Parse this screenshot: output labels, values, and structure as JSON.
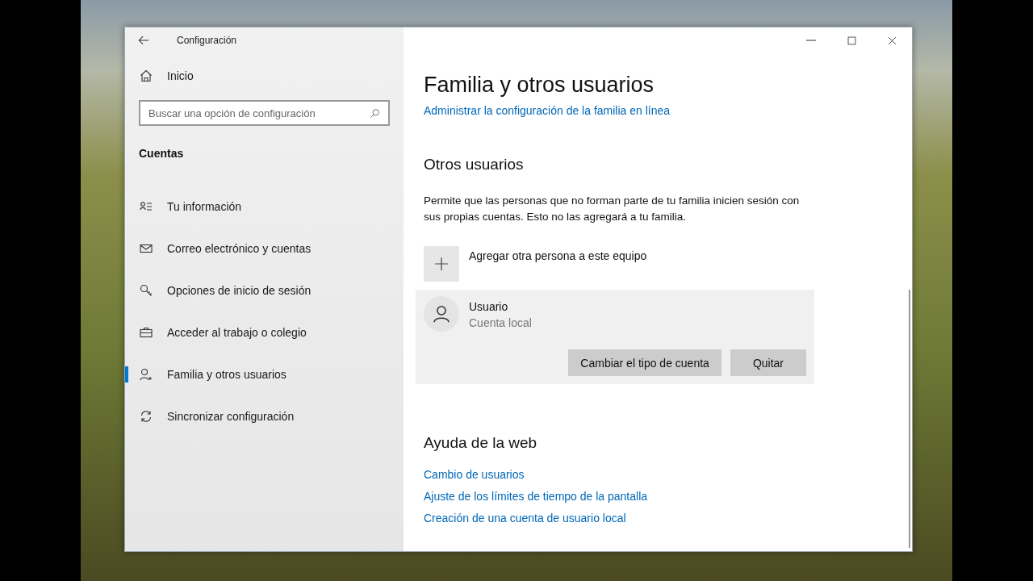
{
  "window": {
    "title": "Configuración"
  },
  "sidebar": {
    "home": "Inicio",
    "search": {
      "placeholder": "Buscar una opción de configuración"
    },
    "section": "Cuentas",
    "items": [
      {
        "label": "Tu información",
        "kind": "info",
        "selected": false
      },
      {
        "label": "Correo electrónico y cuentas",
        "kind": "mail",
        "selected": false
      },
      {
        "label": "Opciones de inicio de sesión",
        "kind": "key",
        "selected": false
      },
      {
        "label": "Acceder al trabajo o colegio",
        "kind": "briefcase",
        "selected": false
      },
      {
        "label": "Familia y otros usuarios",
        "kind": "family",
        "selected": true
      },
      {
        "label": "Sincronizar configuración",
        "kind": "sync",
        "selected": false
      }
    ]
  },
  "main": {
    "title": "Familia y otros usuarios",
    "family_link": "Administrar la configuración de la familia en línea",
    "other_users": {
      "heading": "Otros usuarios",
      "description": "Permite que las personas que no forman parte de tu familia inicien sesión con sus propias cuentas. Esto no las agregará a tu familia.",
      "add_label": "Agregar otra persona a este equipo",
      "user": {
        "name": "Usuario",
        "type": "Cuenta local",
        "expanded": true,
        "buttons": [
          "Cambiar el tipo de cuenta",
          "Quitar"
        ]
      }
    },
    "web_help": {
      "heading": "Ayuda de la web",
      "links": [
        "Cambio de usuarios",
        "Ajuste de los límites de tiempo de la pantalla",
        "Creación de una cuenta de usuario local"
      ]
    }
  }
}
